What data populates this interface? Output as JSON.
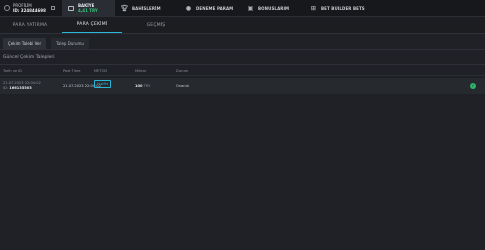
{
  "topbar": {
    "profile_label": "PROFİLİM",
    "user_id": "ID: 324844698",
    "balance_label": "BAKİYE",
    "balance_value": "4,41 TRY",
    "nav": [
      {
        "label": "BAHİSLERİM",
        "icon": "trophy-icon"
      },
      {
        "label": "DENEME PARAM",
        "icon": "chip-icon"
      },
      {
        "label": "BONUSLARIM",
        "icon": "gift-icon"
      },
      {
        "label": "BET BUILDER BETS",
        "icon": "grid-icon"
      }
    ]
  },
  "tabs": [
    "PARA YATIRMA",
    "PARA ÇEKİMİ",
    "GEÇMİŞ"
  ],
  "subtabs": [
    "Çekim Talebi Ver",
    "Talep Durumu"
  ],
  "section_title": "Güncel Çekim Talepleri",
  "table": {
    "headers": [
      "Tarih ve ID",
      "Post Time",
      "METOD",
      "Miktar",
      "Durum"
    ],
    "rows": [
      {
        "date": "21.07.2023 22:04:02",
        "id_prefix": "ID:",
        "id": "166135503",
        "time": "21.07.2023 22:04:02",
        "method": "Hızlıfix",
        "amount": "100",
        "currency": "TRY",
        "status": "Onandı"
      }
    ]
  },
  "colors": {
    "accent": "#2ab6d9",
    "balance": "#37c07a",
    "success": "#2fb46a"
  }
}
